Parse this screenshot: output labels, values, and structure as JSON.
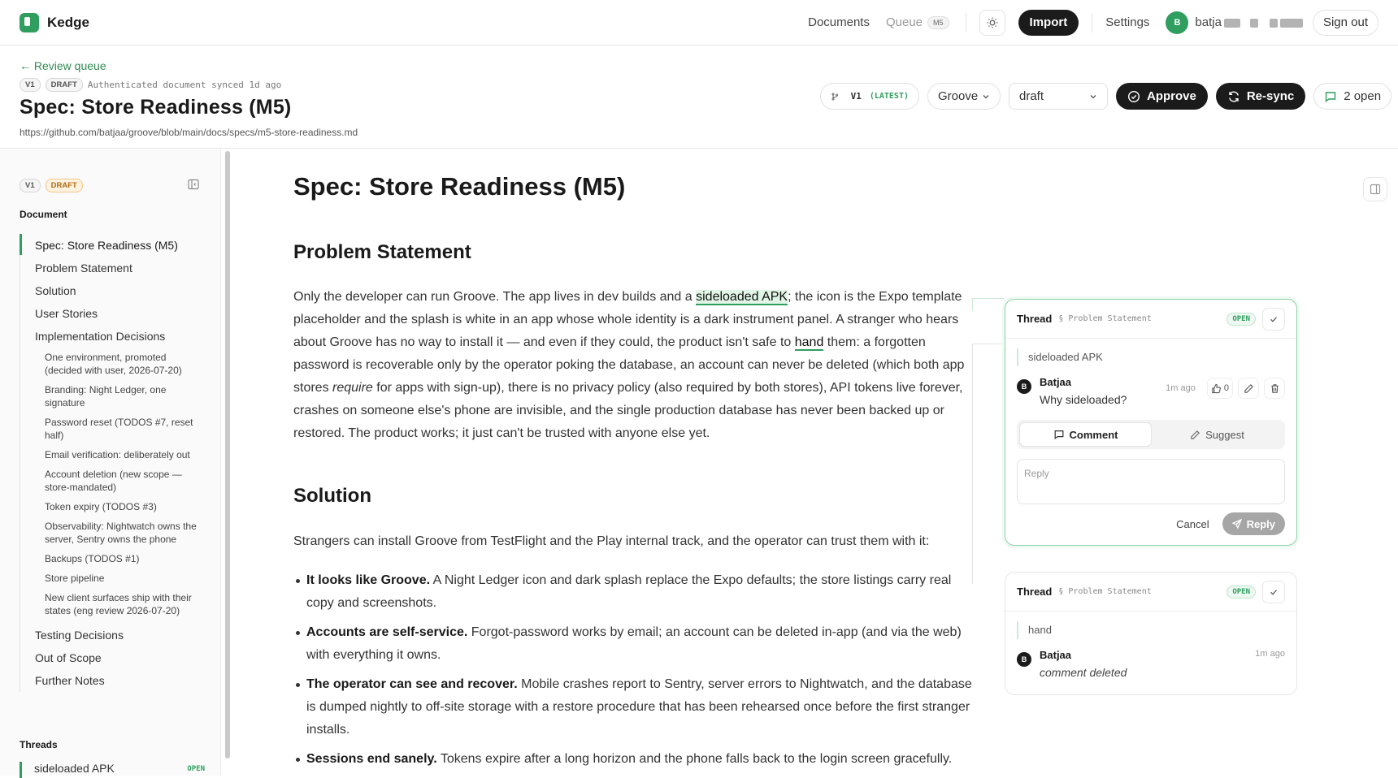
{
  "app": {
    "name": "Kedge"
  },
  "nav": {
    "documents": "Documents",
    "queue": "Queue",
    "queue_badge": "M5",
    "import": "Import",
    "settings": "Settings",
    "user_initial": "B",
    "user_name": "batja",
    "sign_out": "Sign out"
  },
  "doc": {
    "back": "← Review queue",
    "version": "V1",
    "status": "DRAFT",
    "meta": "Authenticated document synced 1d ago",
    "title": "Spec: Store Readiness (M5)",
    "url": "https://github.com/batjaa/groove/blob/main/docs/specs/m5-store-readiness.md",
    "version_pill": "V1",
    "latest": "(LATEST)",
    "project": "Groove",
    "state": "draft",
    "approve": "Approve",
    "resync": "Re-sync",
    "open_threads": "2 open"
  },
  "sidebar": {
    "version": "V1",
    "status": "DRAFT",
    "document_heading": "Document",
    "toc": [
      {
        "label": "Spec: Store Readiness (M5)",
        "level": 1,
        "active": true
      },
      {
        "label": "Problem Statement",
        "level": 1
      },
      {
        "label": "Solution",
        "level": 1
      },
      {
        "label": "User Stories",
        "level": 1
      },
      {
        "label": "Implementation Decisions",
        "level": 1
      },
      {
        "label": "One environment, promoted (decided with user, 2026-07-20)",
        "level": 2
      },
      {
        "label": "Branding: Night Ledger, one signature",
        "level": 2
      },
      {
        "label": "Password reset (TODOS #7, reset half)",
        "level": 2
      },
      {
        "label": "Email verification: deliberately out",
        "level": 2
      },
      {
        "label": "Account deletion (new scope — store-mandated)",
        "level": 2
      },
      {
        "label": "Token expiry (TODOS #3)",
        "level": 2
      },
      {
        "label": "Observability: Nightwatch owns the server, Sentry owns the phone",
        "level": 2
      },
      {
        "label": "Backups (TODOS #1)",
        "level": 2
      },
      {
        "label": "Store pipeline",
        "level": 2
      },
      {
        "label": "New client surfaces ship with their states (eng review 2026-07-20)",
        "level": 2
      },
      {
        "label": "Testing Decisions",
        "level": 1
      },
      {
        "label": "Out of Scope",
        "level": 1
      },
      {
        "label": "Further Notes",
        "level": 1
      }
    ],
    "threads_heading": "Threads",
    "threads": [
      {
        "label": "sideloaded APK",
        "status": "OPEN"
      }
    ]
  },
  "content": {
    "h1": "Spec: Store Readiness (M5)",
    "problem_heading": "Problem Statement",
    "problem": {
      "p1": "Only the developer can run Groove. The app lives in dev builds and a ",
      "hl1": "sideloaded APK",
      "p2": "; the icon is the Expo template placeholder and the splash is white in an app whose whole identity is a dark instrument panel. A stranger who hears about Groove has no way to install it — and even if they could, the product isn't safe to ",
      "hl2": "hand",
      "p3": " them: a forgotten password is recoverable only by the operator poking the database, an account can never be deleted (which both app stores ",
      "em": "require",
      "p4": " for apps with sign-up), there is no privacy policy (also required by both stores), API tokens live forever, crashes on someone else's phone are invisible, and the single production database has never been backed up or restored. The product works; it just can't be trusted with anyone else yet."
    },
    "solution_heading": "Solution",
    "solution_intro": "Strangers can install Groove from TestFlight and the Play internal track, and the operator can trust them with it:",
    "bullets": [
      {
        "bold": "It looks like Groove.",
        "text": " A Night Ledger icon and dark splash replace the Expo defaults; the store listings carry real copy and screenshots."
      },
      {
        "bold": "Accounts are self-service.",
        "text": " Forgot-password works by email; an account can be deleted in-app (and via the web) with everything it owns."
      },
      {
        "bold": "The operator can see and recover.",
        "text": " Mobile crashes report to Sentry, server errors to Nightwatch, and the database is dumped nightly to off-site storage with a restore procedure that has been rehearsed once before the first stranger installs."
      },
      {
        "bold": "Sessions end sanely.",
        "text": " Tokens expire after a long horizon and the phone falls back to the login screen gracefully."
      }
    ]
  },
  "threads": [
    {
      "title": "Thread",
      "section": "§ Problem Statement",
      "status": "OPEN",
      "quote": "sideloaded APK",
      "author_initial": "B",
      "author": "Batjaa",
      "time": "1m ago",
      "text": "Why sideloaded?",
      "likes": "0",
      "tab_comment": "Comment",
      "tab_suggest": "Suggest",
      "reply_placeholder": "Reply",
      "cancel": "Cancel",
      "reply": "Reply"
    },
    {
      "title": "Thread",
      "section": "§ Problem Statement",
      "status": "OPEN",
      "quote": "hand",
      "author_initial": "B",
      "author": "Batjaa",
      "time": "1m ago",
      "text": "comment deleted"
    }
  ],
  "colors": {
    "accent": "#2f9e5f",
    "dark": "#1b1b1b",
    "draft_badge": "#b06a12"
  }
}
